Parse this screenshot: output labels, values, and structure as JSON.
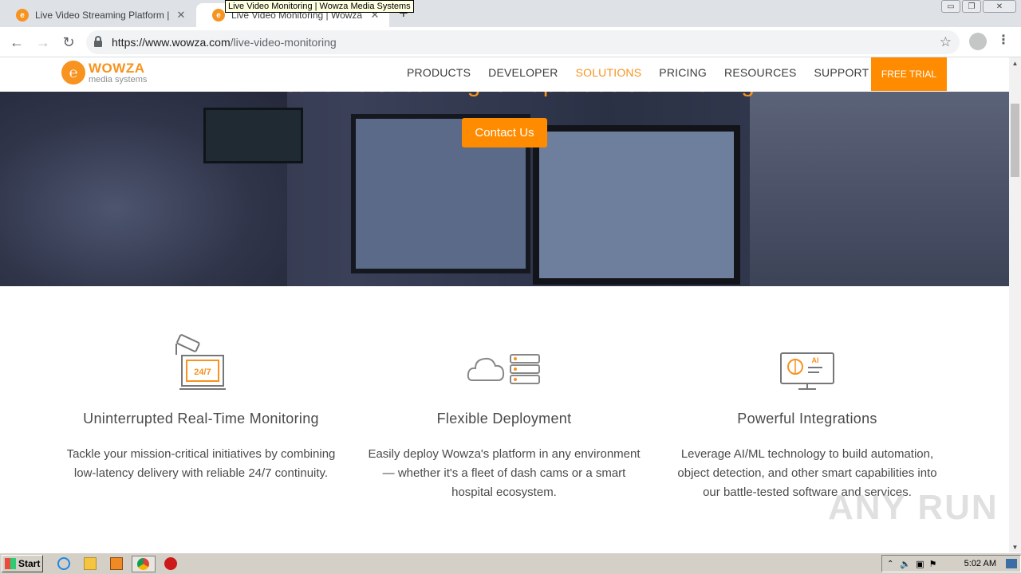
{
  "browser": {
    "tabs": [
      {
        "title": "Live Video Streaming Platform | Wowza",
        "active": false
      },
      {
        "title": "Live Video Monitoring | Wowza Media",
        "active": true
      }
    ],
    "tooltip": "Live Video Monitoring | Wowza Media Systems",
    "new_tab": "+",
    "url_host": "https://www.wowza.com",
    "url_path": "/live-video-monitoring",
    "window_controls": [
      "▭",
      "❐",
      "✕"
    ],
    "nav": {
      "back": "←",
      "forward": "→",
      "reload": "↻",
      "bookmark": "☆",
      "menu": "⋮"
    }
  },
  "site": {
    "logo": {
      "name": "WOWZA",
      "subtitle": "media systems",
      "mark": "℮"
    },
    "nav": [
      {
        "label": "PRODUCTS",
        "active": false
      },
      {
        "label": "DEVELOPER",
        "active": false
      },
      {
        "label": "SOLUTIONS",
        "active": true
      },
      {
        "label": "PRICING",
        "active": false
      },
      {
        "label": "RESOURCES",
        "active": false
      },
      {
        "label": "SUPPORT",
        "active": false
      }
    ],
    "cta": "FREE TRIAL",
    "accent_color": "#ff8c00"
  },
  "hero": {
    "headline": "Real-time streaming for rapid decision-making",
    "button": "Contact Us"
  },
  "features": [
    {
      "icon": "surveillance-camera-icon",
      "title": "Uninterrupted Real-Time Monitoring",
      "description": "Tackle your mission-critical initiatives by combining low-latency delivery with reliable 24/7 continuity.",
      "badge": "24/7"
    },
    {
      "icon": "cloud-server-icon",
      "title": "Flexible Deployment",
      "description": "Easily deploy Wowza's platform in any environment — whether it's a fleet of dash cams or a smart hospital ecosystem."
    },
    {
      "icon": "ai-monitor-icon",
      "title": "Powerful Integrations",
      "description": "Leverage AI/ML technology to build automation, object detection, and other smart capabilities into our battle-tested software and services.",
      "badge": "AI"
    }
  ],
  "watermark": "ANY RUN",
  "taskbar": {
    "start": "Start",
    "clock": "5:02 AM"
  }
}
